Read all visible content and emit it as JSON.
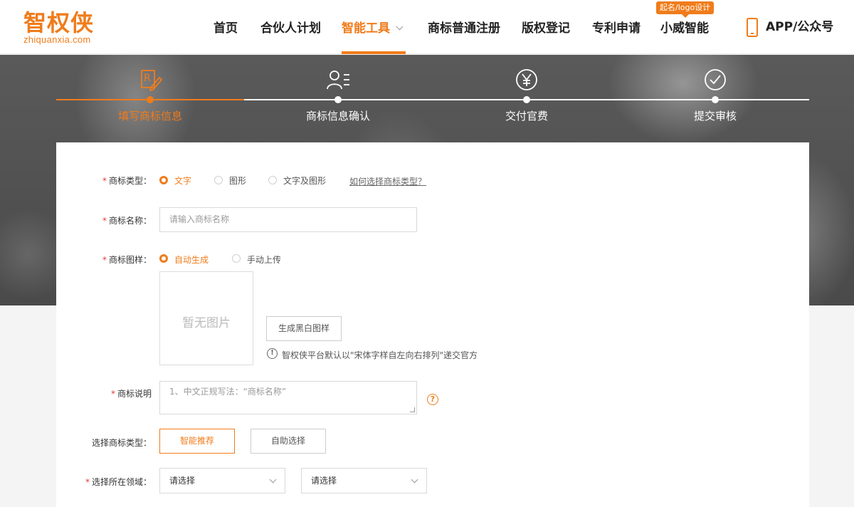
{
  "header": {
    "logo_cn": "智权侠",
    "logo_en": "zhiquanxia.com",
    "nav": [
      {
        "label": "首页"
      },
      {
        "label": "合伙人计划"
      },
      {
        "label": "智能工具"
      },
      {
        "label": "商标普通注册"
      },
      {
        "label": "版权登记"
      },
      {
        "label": "专利申请"
      },
      {
        "label": "小威智能"
      },
      {
        "label": "APP/公众号"
      }
    ],
    "badge": "起名/logo设计",
    "accent_color": "#f07c1b"
  },
  "steps": [
    {
      "label": "填写商标信息",
      "icon": "registered-pen-icon",
      "active": true
    },
    {
      "label": "商标信息确认",
      "icon": "user-list-icon",
      "active": false
    },
    {
      "label": "交付官费",
      "icon": "yen-icon",
      "active": false
    },
    {
      "label": "提交审核",
      "icon": "check-circle-icon",
      "active": false
    }
  ],
  "form": {
    "type_label": "商标类型：",
    "type_options": [
      "文字",
      "图形",
      "文字及图形"
    ],
    "type_help_link": "如何选择商标类型？",
    "name_label": "商标名称：",
    "name_placeholder": "请输入商标名称",
    "pattern_label": "商标图样：",
    "pattern_options": [
      "自动生成",
      "手动上传"
    ],
    "no_image": "暂无图片",
    "generate_btn": "生成黑白图样",
    "pattern_note": "智权侠平台默认以\"宋体字样自左向右排列\"递交官方",
    "desc_label": "商标说明",
    "desc_placeholder": "1、中文正规写法：“商标名称”",
    "choose_type_label": "选择商标类型：",
    "smart_btn": "智能推荐",
    "self_btn": "自助选择",
    "field_label": "选择所在领域：",
    "select_placeholder": "请选择"
  }
}
